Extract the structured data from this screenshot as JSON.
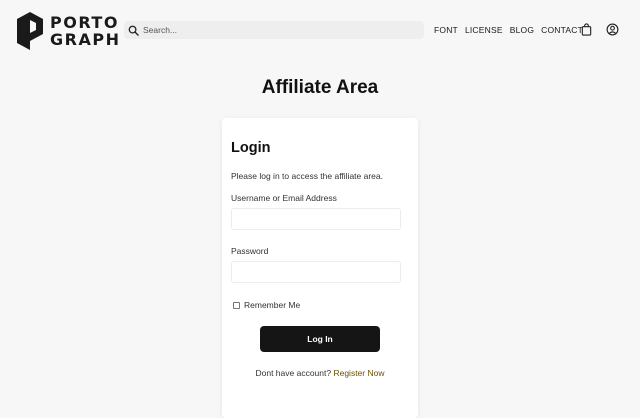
{
  "header": {
    "logo": {
      "line1": "PORTO",
      "line2": "GRAPH",
      "icon": "portograph-logo-icon"
    },
    "search": {
      "placeholder": "Search...",
      "value": "",
      "icon": "search-icon"
    },
    "nav": [
      {
        "label": "FONT"
      },
      {
        "label": "LICENSE"
      },
      {
        "label": "BLOG"
      },
      {
        "label": "CONTACT"
      }
    ],
    "icons": [
      "shopping-bag-icon",
      "user-icon"
    ]
  },
  "page": {
    "title": "Affiliate Area"
  },
  "login": {
    "title": "Login",
    "intro": "Please log in to access the affiliate area.",
    "username_label": "Username or Email Address",
    "username_value": "",
    "password_label": "Password",
    "password_value": "",
    "remember_label": "Remember Me",
    "remember_checked": false,
    "submit_label": "Log In",
    "register_prompt": "Dont have account?",
    "register_link": "Register Now"
  },
  "colors": {
    "background": "#f7f7f7",
    "card": "#ffffff",
    "button": "#151515",
    "link": "#6b5200",
    "search_bg": "#eeeeee"
  }
}
